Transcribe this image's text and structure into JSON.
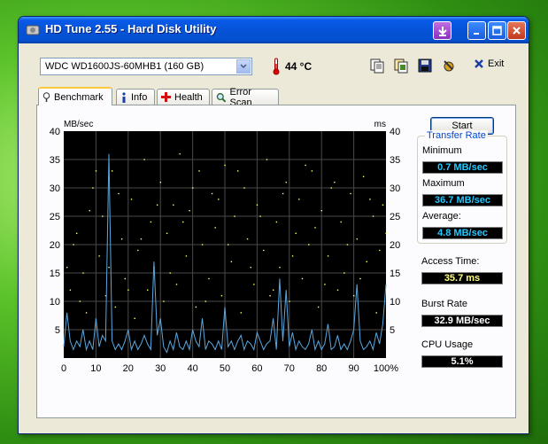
{
  "window": {
    "title": "HD Tune 2.55 - Hard Disk Utility",
    "exit_label": "Exit"
  },
  "toolbar": {
    "drive": "WDC WD1600JS-60MHB1 (160 GB)",
    "temperature": "44 °C",
    "icons": [
      "copy-text-icon",
      "copy-screenshot-icon",
      "save-icon",
      "options-icon"
    ]
  },
  "tabs": [
    {
      "label": "Benchmark",
      "icon": "benchmark-icon",
      "active": true
    },
    {
      "label": "Info",
      "icon": "info-icon",
      "active": false
    },
    {
      "label": "Health",
      "icon": "health-icon",
      "active": false
    },
    {
      "label": "Error Scan",
      "icon": "error-scan-icon",
      "active": false
    }
  ],
  "benchmark": {
    "start_label": "Start",
    "transfer_rate": {
      "title": "Transfer Rate",
      "minimum_label": "Minimum",
      "minimum": "0.7 MB/sec",
      "maximum_label": "Maximum",
      "maximum": "36.7 MB/sec",
      "average_label": "Average:",
      "average": "4.8 MB/sec"
    },
    "access_time_label": "Access Time:",
    "access_time": "35.7 ms",
    "burst_rate_label": "Burst Rate",
    "burst_rate": "32.9 MB/sec",
    "cpu_usage_label": "CPU Usage",
    "cpu_usage": "5.1%"
  },
  "colors": {
    "transfer_line": "#5aa8e0",
    "access_dots": "#ffff66",
    "grid": "#4a4a4a",
    "value_cyan": "#22c8ff",
    "value_yellow": "#ffff80",
    "value_white": "#ffffff"
  },
  "chart_data": {
    "type": "line",
    "ylabel_left": "MB/sec",
    "ylabel_right": "ms",
    "ylim": [
      0,
      40
    ],
    "yticks": [
      "40",
      "35",
      "30",
      "25",
      "20",
      "15",
      "10",
      "5"
    ],
    "xlim": [
      0,
      100
    ],
    "xticks": [
      "0",
      "10",
      "20",
      "30",
      "40",
      "50",
      "60",
      "70",
      "80",
      "90",
      "100%"
    ],
    "grid": true,
    "series": [
      {
        "x": [
          0,
          1,
          2,
          3,
          4,
          5,
          6,
          7,
          8,
          9,
          10,
          11,
          12,
          13,
          14,
          15,
          16,
          17,
          18,
          19,
          20,
          21,
          22,
          23,
          24,
          25,
          26,
          27,
          28,
          29,
          30,
          31,
          32,
          33,
          34,
          35,
          36,
          37,
          38,
          39,
          40,
          41,
          42,
          43,
          44,
          45,
          46,
          47,
          48,
          49,
          50,
          51,
          52,
          53,
          54,
          55,
          56,
          57,
          58,
          59,
          60,
          61,
          62,
          63,
          64,
          65,
          66,
          67,
          68,
          69,
          70,
          71,
          72,
          73,
          74,
          75,
          76,
          77,
          78,
          79,
          80,
          81,
          82,
          83,
          84,
          85,
          86,
          87,
          88,
          89,
          90,
          91,
          92,
          93,
          94,
          95,
          96,
          97,
          98,
          99,
          100
        ],
        "values": [
          2,
          8,
          3,
          1.5,
          3,
          2,
          5,
          1.5,
          3,
          1.5,
          7,
          2,
          4,
          3,
          36,
          3,
          1.5,
          2.5,
          1.5,
          3,
          5,
          1.5,
          3,
          1.5,
          2.5,
          4,
          2.5,
          1.5,
          17,
          4,
          7,
          2,
          1,
          3,
          1.5,
          4.5,
          2,
          1.5,
          3,
          1.5,
          5,
          3,
          2,
          7,
          1.5,
          3,
          2.5,
          1.5,
          3,
          1.5,
          9,
          2,
          3,
          1.5,
          3,
          4,
          1.5,
          3,
          2.5,
          1.5,
          4.5,
          3,
          1.5,
          2.5,
          3,
          7,
          1.5,
          14,
          3,
          12,
          2,
          4.5,
          1.5,
          3,
          2,
          1.5,
          2.5,
          5,
          1.5,
          3,
          1.5,
          2.5,
          6,
          1.5,
          2,
          4,
          1.5,
          2.5,
          1.5,
          3,
          5,
          13,
          3,
          1.5,
          2,
          3,
          1.5,
          4.5,
          2.5,
          6,
          13
        ]
      }
    ],
    "access_time_scatter_ms": [
      [
        2,
        12
      ],
      [
        4,
        22
      ],
      [
        6,
        15
      ],
      [
        7,
        8
      ],
      [
        9,
        30
      ],
      [
        11,
        18
      ],
      [
        12,
        25
      ],
      [
        13,
        11
      ],
      [
        15,
        33
      ],
      [
        16,
        9
      ],
      [
        18,
        21
      ],
      [
        19,
        14
      ],
      [
        21,
        28
      ],
      [
        22,
        7
      ],
      [
        23,
        19
      ],
      [
        25,
        35
      ],
      [
        26,
        12
      ],
      [
        27,
        24
      ],
      [
        28,
        16
      ],
      [
        30,
        31
      ],
      [
        31,
        10
      ],
      [
        32,
        22
      ],
      [
        34,
        27
      ],
      [
        35,
        13
      ],
      [
        36,
        36
      ],
      [
        38,
        18
      ],
      [
        39,
        26
      ],
      [
        41,
        9
      ],
      [
        42,
        33
      ],
      [
        43,
        20
      ],
      [
        45,
        14
      ],
      [
        46,
        29
      ],
      [
        47,
        23
      ],
      [
        49,
        11
      ],
      [
        50,
        34
      ],
      [
        52,
        17
      ],
      [
        53,
        25
      ],
      [
        55,
        8
      ],
      [
        56,
        30
      ],
      [
        57,
        21
      ],
      [
        59,
        13
      ],
      [
        60,
        27
      ],
      [
        62,
        19
      ],
      [
        63,
        35
      ],
      [
        65,
        12
      ],
      [
        66,
        24
      ],
      [
        67,
        16
      ],
      [
        69,
        31
      ],
      [
        70,
        10
      ],
      [
        72,
        22
      ],
      [
        73,
        28
      ],
      [
        74,
        14
      ],
      [
        76,
        20
      ],
      [
        77,
        33
      ],
      [
        79,
        9
      ],
      [
        80,
        26
      ],
      [
        82,
        18
      ],
      [
        83,
        30
      ],
      [
        85,
        12
      ],
      [
        86,
        24
      ],
      [
        87,
        15
      ],
      [
        89,
        29
      ],
      [
        90,
        11
      ],
      [
        91,
        21
      ],
      [
        93,
        32
      ],
      [
        94,
        17
      ],
      [
        96,
        25
      ],
      [
        97,
        8
      ],
      [
        98,
        19
      ],
      [
        99,
        27
      ],
      [
        3,
        20
      ],
      [
        5,
        10
      ],
      [
        8,
        26
      ],
      [
        10,
        33
      ],
      [
        14,
        16
      ],
      [
        17,
        29
      ],
      [
        20,
        12
      ],
      [
        24,
        21
      ],
      [
        29,
        27
      ],
      [
        33,
        15
      ],
      [
        37,
        24
      ],
      [
        40,
        30
      ],
      [
        44,
        10
      ],
      [
        48,
        28
      ],
      [
        51,
        20
      ],
      [
        54,
        33
      ],
      [
        58,
        16
      ],
      [
        61,
        25
      ],
      [
        64,
        11
      ],
      [
        68,
        29
      ],
      [
        71,
        18
      ],
      [
        75,
        34
      ],
      [
        78,
        23
      ],
      [
        81,
        13
      ],
      [
        84,
        31
      ],
      [
        88,
        20
      ],
      [
        92,
        14
      ],
      [
        95,
        28
      ],
      [
        1,
        16
      ],
      [
        100,
        22
      ]
    ]
  }
}
